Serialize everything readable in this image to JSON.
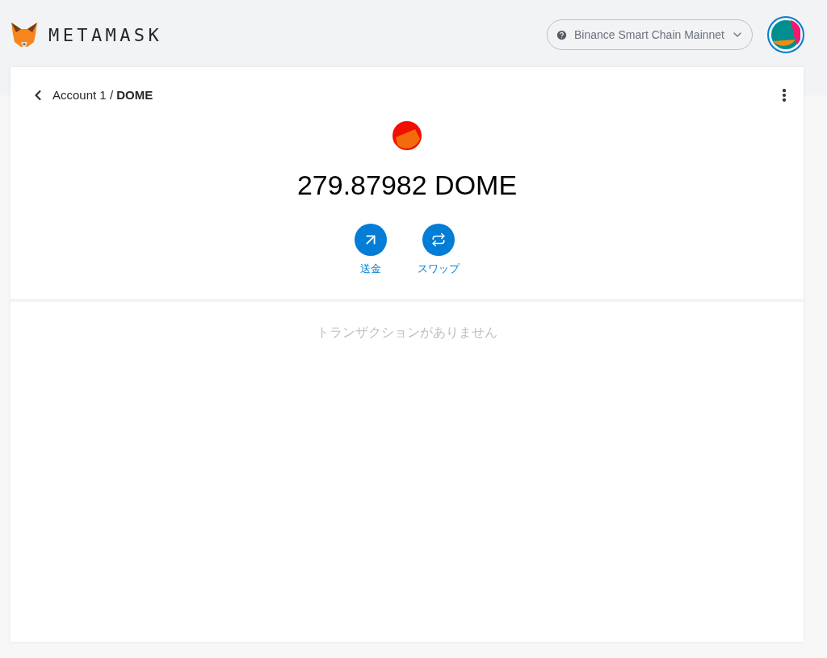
{
  "header": {
    "logo_text": "METAMASK",
    "network": "Binance Smart Chain Mainnet"
  },
  "breadcrumb": "Account 1 / **DOME**",
  "balance": "279.87982 DOME",
  "actions": [
    {
      "kind": "send",
      "label": "送金"
    },
    {
      "kind": "swap",
      "label": "スワップ"
    }
  ],
  "empty_message": "トランザクションがありません"
}
